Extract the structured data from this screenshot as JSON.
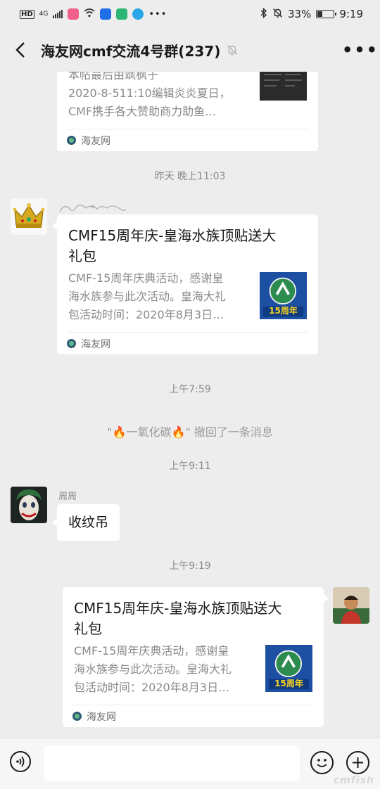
{
  "status_bar": {
    "hd": "HD",
    "network": "4G",
    "battery_percent": "33%",
    "time": "9:19",
    "battery_level": 0.33
  },
  "header": {
    "title": "海友网cmf交流4号群(237)"
  },
  "messages": {
    "card_top": {
      "desc_lines": [
        "本帖最后由飒枫于",
        "2020-8-511:10编辑炎炎夏日，",
        "CMF携手各大赞助商力助鱼…"
      ],
      "source": "海友网"
    },
    "time1": "昨天 晚上11:03",
    "card_mid": {
      "title_lines": [
        "CMF15周年庆-皇海水族顶贴送大",
        "礼包"
      ],
      "desc_lines": [
        "CMF-15周年庆典活动，感谢皇",
        "海水族参与此次活动。皇海大礼",
        "包活动时间：2020年8月3日…"
      ],
      "source": "海友网",
      "thumb_text": "15周年"
    },
    "time2": "上午7:59",
    "recall": {
      "prefix": "\"",
      "name": "一氧化碳",
      "suffix": "\" 撤回了一条消息"
    },
    "time3": "上午9:11",
    "text_msg": {
      "sender": "周周",
      "text": "收纹吊"
    },
    "time4": "上午9:19",
    "card_self": {
      "title_lines": [
        "CMF15周年庆-皇海水族顶贴送大",
        "礼包"
      ],
      "desc_lines": [
        "CMF-15周年庆典活动，感谢皇",
        "海水族参与此次活动。皇海大礼",
        "包活动时间：2020年8月3日…"
      ],
      "source": "海友网",
      "thumb_text": "15周年"
    }
  },
  "input": {
    "value": "",
    "placeholder": ""
  },
  "watermark": "cmfish"
}
